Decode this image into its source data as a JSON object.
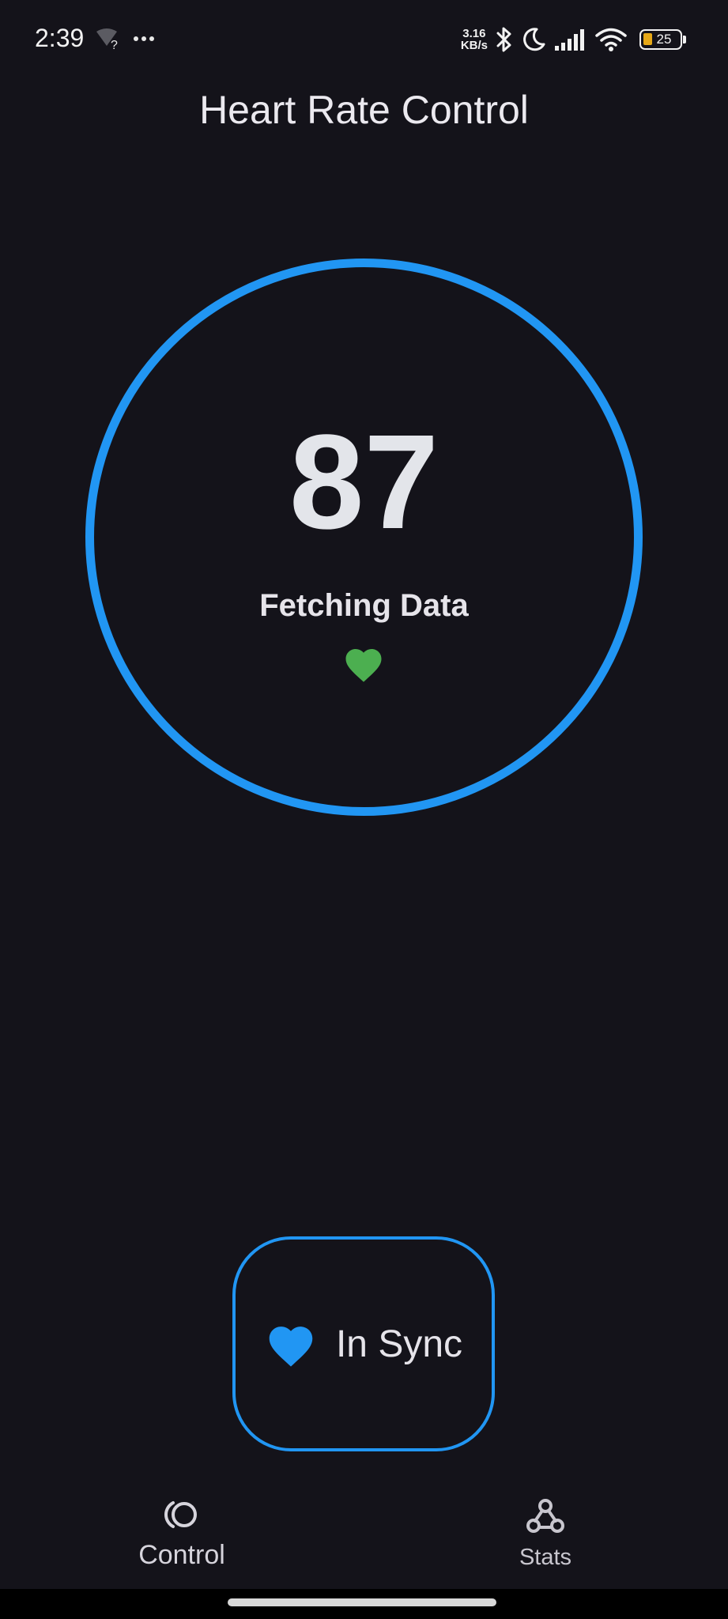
{
  "status_bar": {
    "time": "2:39",
    "net_speed_value": "3.16",
    "net_speed_unit": "KB/s",
    "battery_level": "25",
    "icons": [
      "wifi-unknown-icon",
      "more-dots-icon",
      "bluetooth-icon",
      "moon-icon",
      "signal-icon",
      "wifi-icon",
      "battery-icon"
    ]
  },
  "app": {
    "title": "Heart Rate Control"
  },
  "monitor": {
    "bpm": "87",
    "status_text": "Fetching Data",
    "status_icon": "heart-icon",
    "status_icon_color": "#4caf50",
    "ring_color": "#2196f3"
  },
  "sync_button": {
    "label": "In Sync",
    "icon": "heart-icon",
    "icon_color": "#2196f3"
  },
  "bottom_nav": {
    "items": [
      {
        "label": "Control",
        "icon": "control-icon",
        "selected": true
      },
      {
        "label": "Stats",
        "icon": "webhook-icon",
        "selected": false
      }
    ]
  },
  "colors": {
    "background": "#14131a",
    "accent": "#2196f3",
    "text": "#e6e4ea"
  }
}
